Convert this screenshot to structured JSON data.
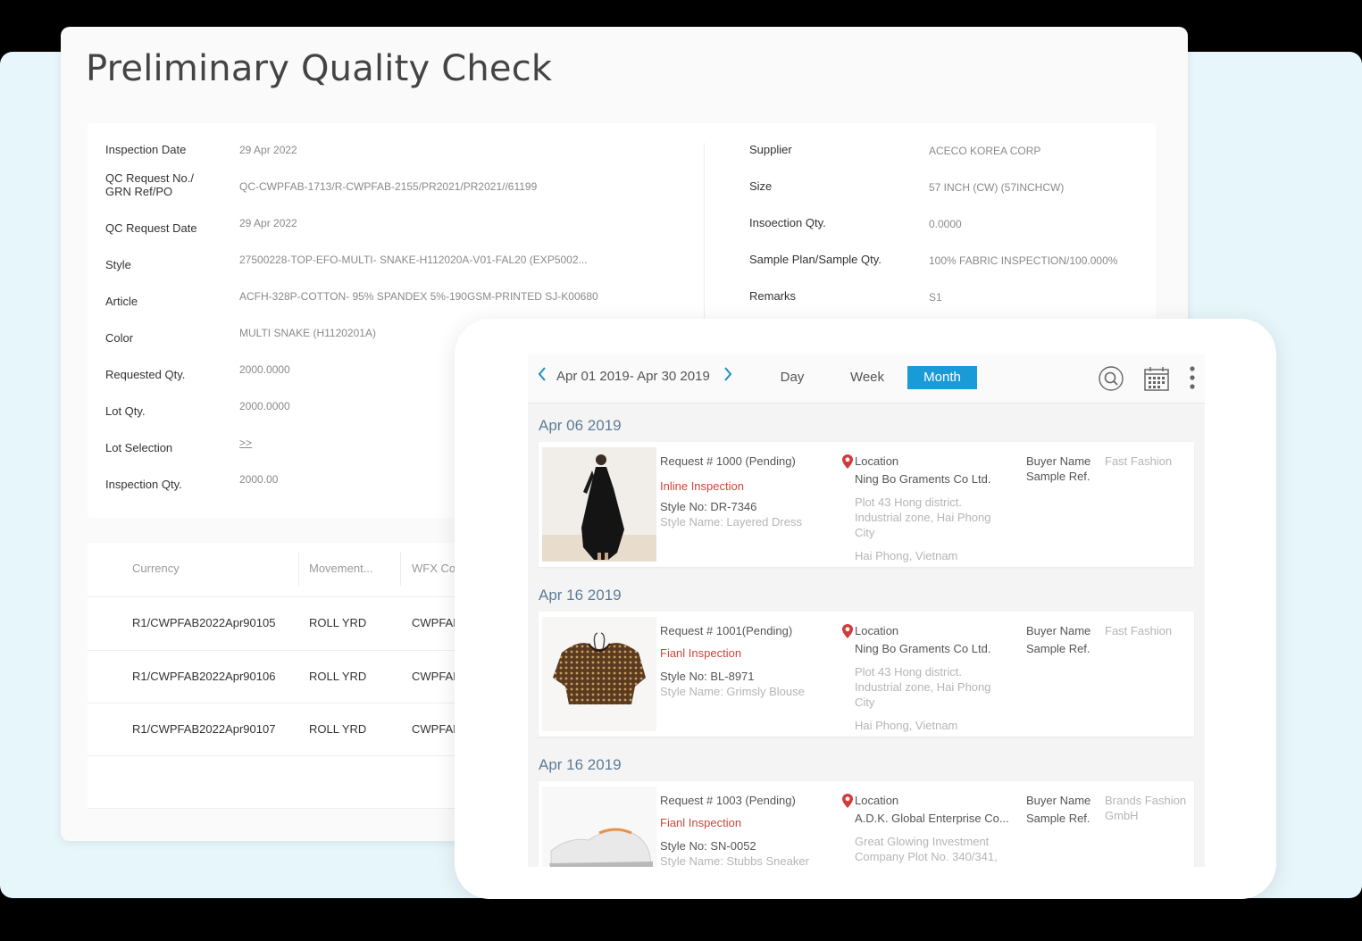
{
  "qc": {
    "title": "Preliminary Quality Check",
    "left_fields": [
      {
        "label": "Inspection Date",
        "value": "29 Apr 2022"
      },
      {
        "label": "QC Request No./\nGRN Ref/PO",
        "value": "QC-CWPFAB-1713/R-CWPFAB-2155/PR2021/PR2021//61199"
      },
      {
        "label": "QC Request Date",
        "value": "29 Apr 2022"
      },
      {
        "label": "Style",
        "value": "27500228-TOP-EFO-MULTI- SNAKE-H112020A-V01-FAL20 (EXP5002..."
      },
      {
        "label": "Article",
        "value": "ACFH-328P-COTTON- 95% SPANDEX 5%-190GSM-PRINTED SJ-K00680"
      },
      {
        "label": "Color",
        "value": "MULTI SNAKE (H1120201A)"
      },
      {
        "label": "Requested Qty.",
        "value": "2000.0000"
      },
      {
        "label": "Lot Qty.",
        "value": "2000.0000"
      },
      {
        "label": "Lot Selection",
        "value": ">>"
      },
      {
        "label": "Inspection Qty.",
        "value": "2000.00"
      }
    ],
    "right_fields": [
      {
        "label": "Supplier",
        "value": "ACECO KOREA CORP"
      },
      {
        "label": "Size",
        "value": "57 INCH (CW) (57INCHCW)"
      },
      {
        "label": "Insoection Qty.",
        "value": "0.0000"
      },
      {
        "label": "Sample Plan/Sample Qty.",
        "value": "100% FABRIC INSPECTION/100.000%"
      },
      {
        "label": "Remarks",
        "value": "S1"
      }
    ],
    "table": {
      "headers": [
        "Currency",
        "Movement...",
        "WFX Co"
      ],
      "rows": [
        [
          "R1/CWPFAB2022Apr90105",
          "ROLL YRD",
          "CWPFAB"
        ],
        [
          "R1/CWPFAB2022Apr90106",
          "ROLL YRD",
          "CWPFAB"
        ],
        [
          "R1/CWPFAB2022Apr90107",
          "ROLL YRD",
          "CWPFAB"
        ]
      ]
    }
  },
  "calendar": {
    "date_range": "Apr 01 2019- Apr 30 2019",
    "views": [
      "Day",
      "Week",
      "Month"
    ],
    "active_view": "Month",
    "icons": [
      "chevron-left-icon",
      "chevron-right-icon",
      "search-icon",
      "calendar-icon",
      "more-vertical-icon"
    ],
    "accent": "#1a9ad6",
    "groups": [
      {
        "date": "Apr 06 2019",
        "request": {
          "request_no": "Request # 1000 (Pending)",
          "inspection_type": "Inline Inspection",
          "style_no": "Style No: DR-7346",
          "style_name": "Style Name: Layered Dress",
          "location_label": "Location",
          "company": "Ning Bo Graments Co Ltd.",
          "address_1": "Plot 43 Hong district.",
          "address_2": "Industrial zone, Hai Phong",
          "address_3": "City",
          "address_4": "Hai Phong, Vietnam",
          "buyer_label": "Buyer Name",
          "buyer_value": "Fast Fashion",
          "sample_label": "Sample Ref.",
          "sample_value": ""
        }
      },
      {
        "date": "Apr 16 2019",
        "request": {
          "request_no": "Request # 1001(Pending)",
          "inspection_type": "Fianl Inspection",
          "style_no": "Style No: BL-8971",
          "style_name": "Style Name: Grimsly Blouse",
          "location_label": "Location",
          "company": "Ning Bo Graments Co Ltd.",
          "address_1": "Plot 43 Hong district.",
          "address_2": "Industrial zone, Hai Phong",
          "address_3": "City",
          "address_4": "Hai Phong, Vietnam",
          "buyer_label": "Buyer Name",
          "buyer_value": "Fast Fashion",
          "sample_label": "Sample Ref.",
          "sample_value": ""
        }
      },
      {
        "date": "Apr 16 2019",
        "request": {
          "request_no": "Request # 1003 (Pending)",
          "inspection_type": "Fianl Inspection",
          "style_no": "Style No: SN-0052",
          "style_name": "Style Name: Stubbs Sneaker",
          "location_label": "Location",
          "company": "A.D.K. Global Enterprise Co...",
          "address_1": "Great Glowing Investment",
          "address_2": "Company Plot No. 340/341,",
          "address_3": "",
          "address_4": "",
          "buyer_label": "Buyer Name",
          "buyer_value": "Brands Fashion",
          "buyer_value_2": "GmbH",
          "sample_label": "Sample Ref.",
          "sample_value": ""
        }
      }
    ]
  }
}
